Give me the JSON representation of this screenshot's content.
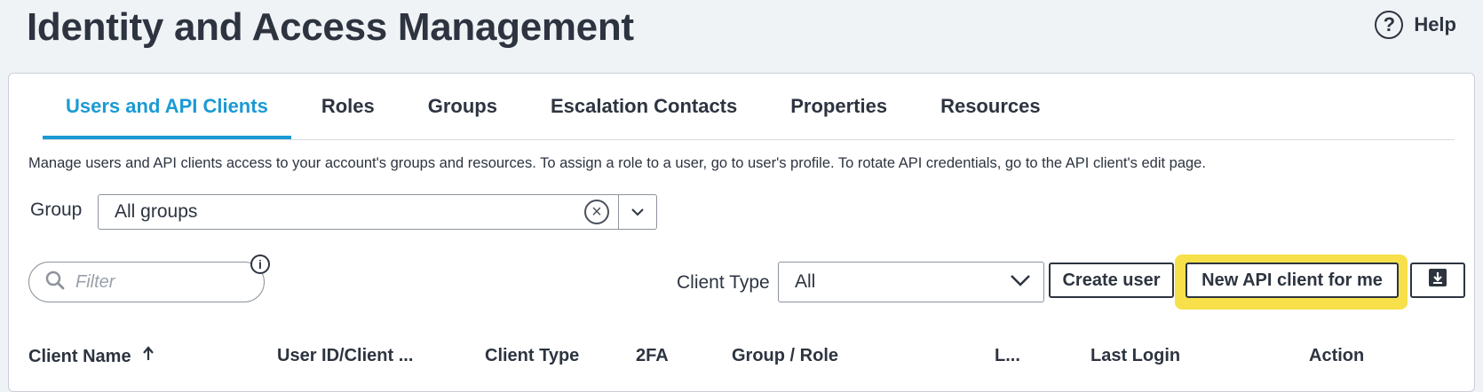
{
  "header": {
    "title": "Identity and Access Management",
    "help_label": "Help",
    "help_icon": "help-circle-icon"
  },
  "tabs": [
    {
      "label": "Users and API Clients",
      "active": true
    },
    {
      "label": "Roles",
      "active": false
    },
    {
      "label": "Groups",
      "active": false
    },
    {
      "label": "Escalation Contacts",
      "active": false
    },
    {
      "label": "Properties",
      "active": false
    },
    {
      "label": "Resources",
      "active": false
    }
  ],
  "description": "Manage users and API clients access to your account's groups and resources. To assign a role to a user, go to user's profile. To rotate API credentials, go to the API client's edit page.",
  "group_filter": {
    "label": "Group",
    "value": "All groups"
  },
  "filter": {
    "placeholder": "Filter"
  },
  "client_type": {
    "label": "Client Type",
    "value": "All"
  },
  "buttons": {
    "create_user": "Create user",
    "new_api_client": "New API client for me",
    "download_icon": "download-icon"
  },
  "colors": {
    "accent": "#1b9ad3",
    "highlight": "#f7e04a",
    "text": "#2d3440",
    "background": "#f0f3f6"
  },
  "table": {
    "columns": [
      {
        "label": "Client Name",
        "sorted": "ascending"
      },
      {
        "label": "User ID/Client ..."
      },
      {
        "label": "Client Type"
      },
      {
        "label": "2FA"
      },
      {
        "label": "Group / Role"
      },
      {
        "label": "L..."
      },
      {
        "label": "Last Login"
      },
      {
        "label": "Action"
      }
    ]
  }
}
